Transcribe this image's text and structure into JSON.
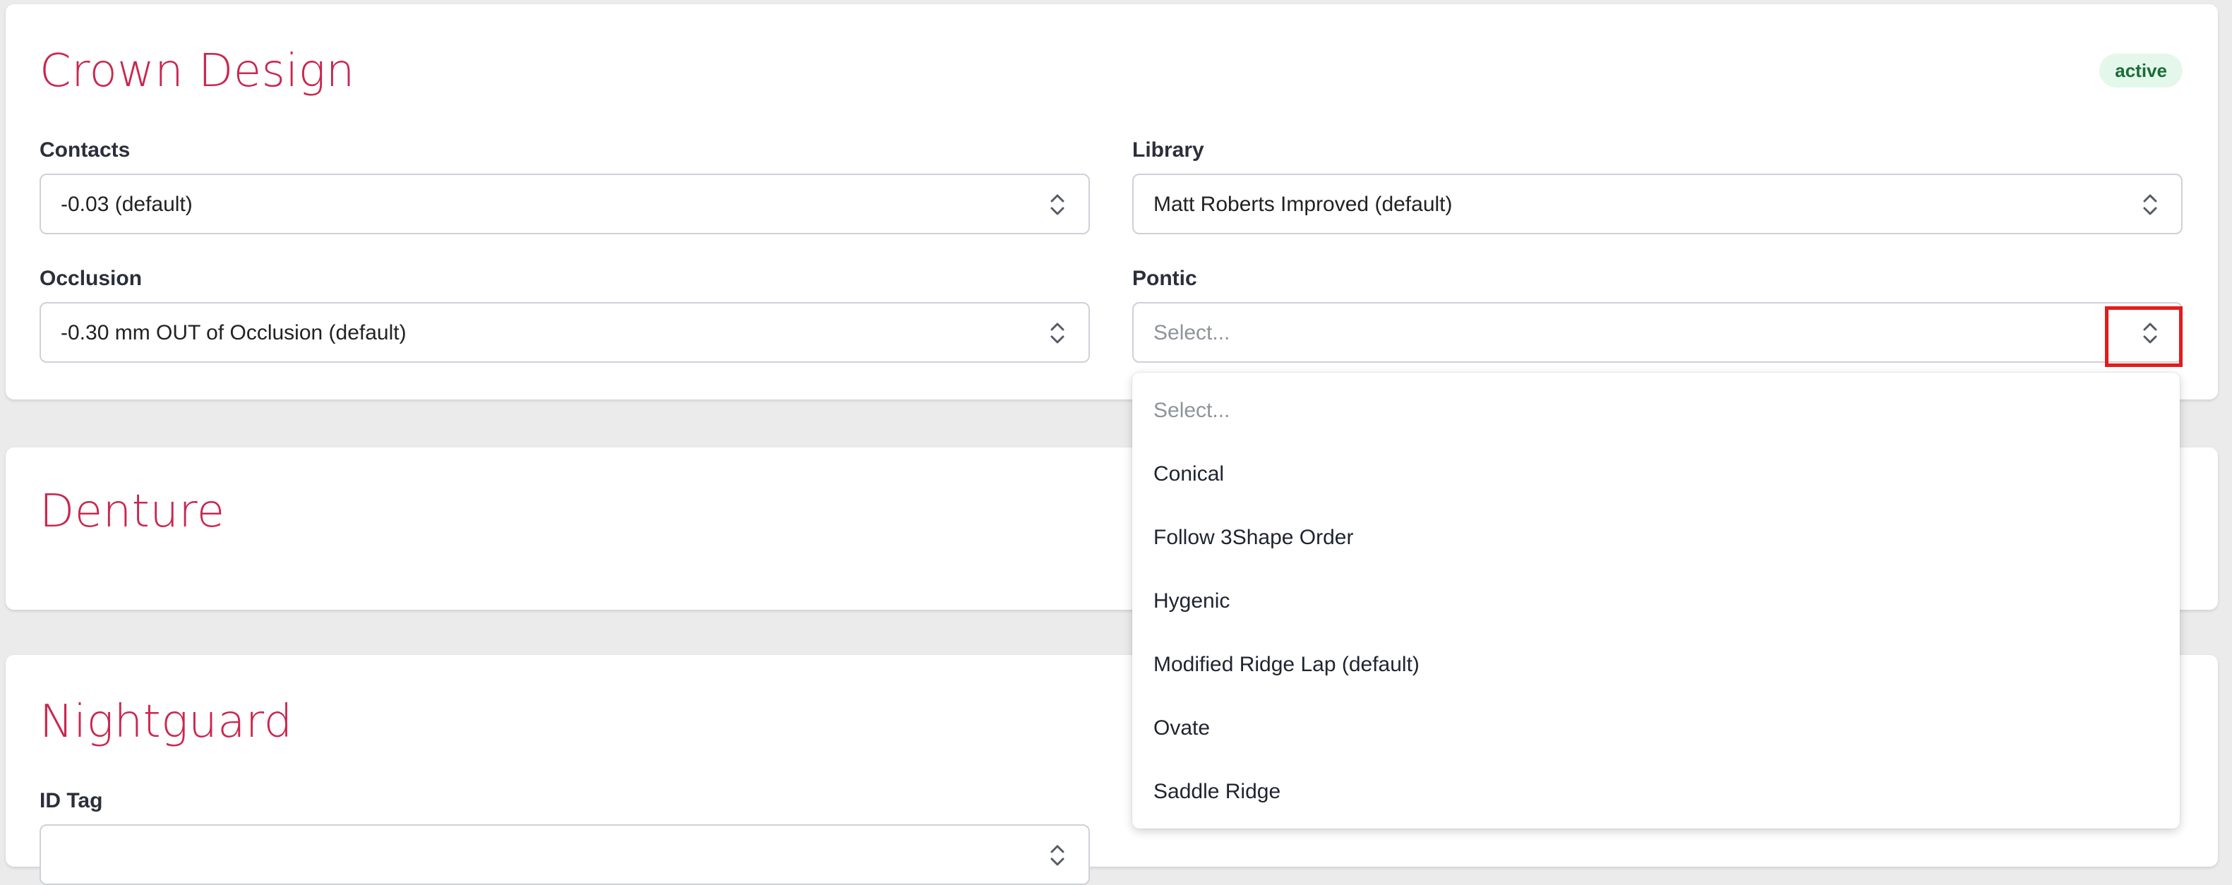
{
  "crown_design": {
    "title": "Crown Design",
    "status_badge": "active",
    "contacts": {
      "label": "Contacts",
      "value": "-0.03 (default)"
    },
    "library": {
      "label": "Library",
      "value": "Matt Roberts Improved (default)"
    },
    "occlusion": {
      "label": "Occlusion",
      "value": "-0.30 mm OUT of Occlusion (default)"
    },
    "pontic": {
      "label": "Pontic",
      "placeholder": "Select...",
      "options": [
        "Select...",
        "Conical",
        "Follow 3Shape Order",
        "Hygenic",
        "Modified Ridge Lap (default)",
        "Ovate",
        "Saddle Ridge"
      ]
    }
  },
  "denture": {
    "title": "Denture"
  },
  "nightguard": {
    "title": "Nightguard",
    "id_tag": {
      "label": "ID Tag"
    }
  },
  "icons": {
    "select_chevron": "chevron-up-down-icon"
  },
  "colors": {
    "section_title": "#c9274f",
    "badge_bg": "#e3f8ea",
    "badge_text": "#1d6b3a",
    "highlight": "#e21c1c"
  }
}
